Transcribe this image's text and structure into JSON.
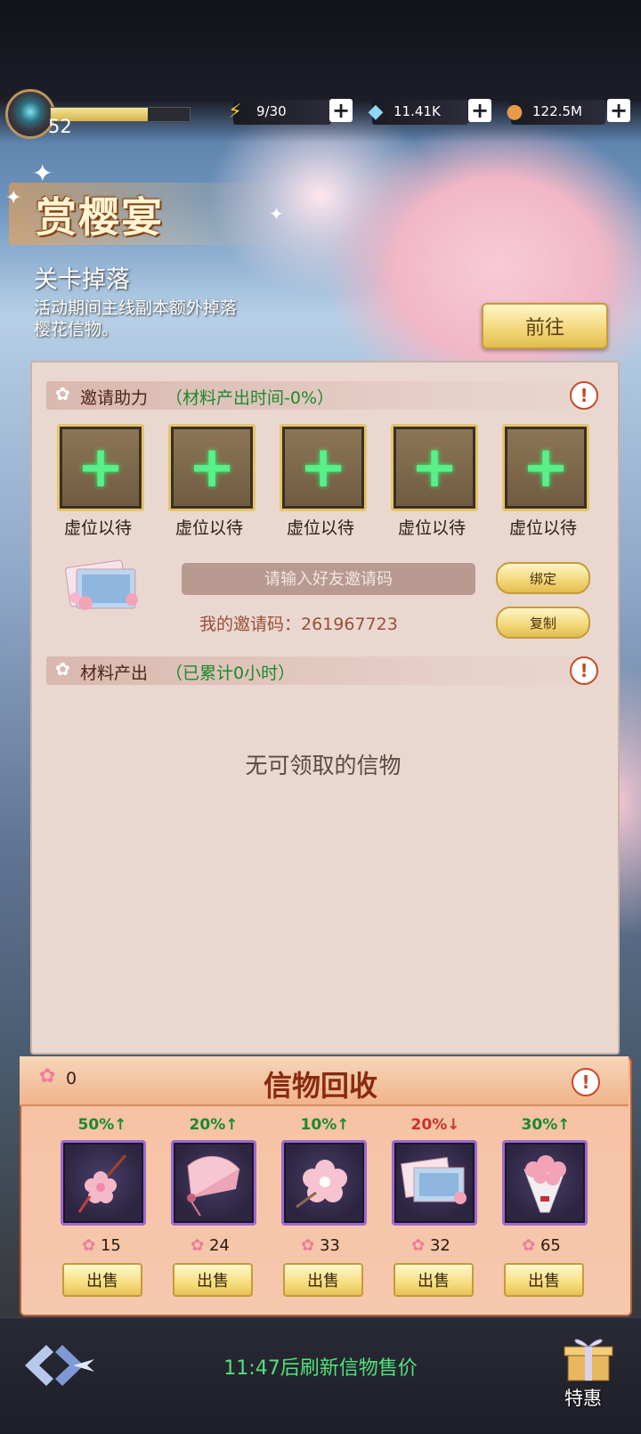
{
  "topbar": {
    "level": "52",
    "xp_fraction": 0.7,
    "energy": {
      "icon": "lightning-icon",
      "value": "9/30"
    },
    "gems": {
      "icon": "diamond-icon",
      "value": "11.41K"
    },
    "coins": {
      "icon": "coin-icon",
      "value": "122.5M"
    }
  },
  "event": {
    "title": "赏樱宴",
    "subtitle": "关卡掉落",
    "description": "活动期间主线副本额外掉落樱花信物。",
    "goto_label": "前往"
  },
  "invite": {
    "section_label": "邀请助力",
    "section_note": "（材料产出时间-0%）",
    "slots": [
      {
        "label": "虚位以待"
      },
      {
        "label": "虚位以待"
      },
      {
        "label": "虚位以待"
      },
      {
        "label": "虚位以待"
      },
      {
        "label": "虚位以待"
      }
    ],
    "input_placeholder": "请输入好友邀请码",
    "my_code_text": "我的邀请码：261967723",
    "bind_label": "绑定",
    "copy_label": "复制"
  },
  "material": {
    "section_label": "材料产出",
    "section_note": "（已累计0小时）",
    "empty_text": "无可领取的信物"
  },
  "recycle": {
    "title": "信物回收",
    "petals": "0",
    "items": [
      {
        "name": "sakura-charm",
        "pct": "50%↑",
        "trend": "up",
        "price": "15",
        "sell": "出售"
      },
      {
        "name": "folding-fan",
        "pct": "20%↑",
        "trend": "up",
        "price": "24",
        "sell": "出售"
      },
      {
        "name": "sakura-hairpin",
        "pct": "10%↑",
        "trend": "up",
        "price": "33",
        "sell": "出售"
      },
      {
        "name": "postcards",
        "pct": "20%↓",
        "trend": "down",
        "price": "32",
        "sell": "出售"
      },
      {
        "name": "flower-bouquet",
        "pct": "30%↑",
        "trend": "up",
        "price": "65",
        "sell": "出售"
      }
    ],
    "colors": {
      "up": "#1a8a2e",
      "down": "#c8322a"
    }
  },
  "footer": {
    "refresh_text": "11:47后刷新信物售价",
    "deal_label": "特惠"
  }
}
